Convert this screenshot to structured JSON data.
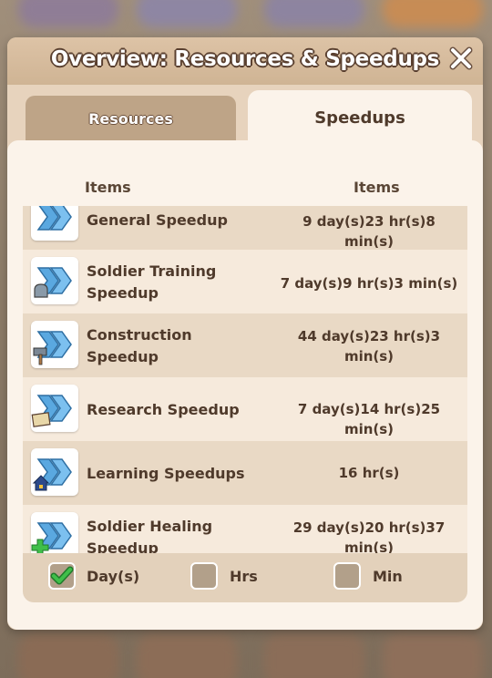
{
  "dialog": {
    "title": "Overview: Resources & Speedups",
    "tabs": [
      {
        "label": "Resources",
        "active": false
      },
      {
        "label": "Speedups",
        "active": true
      }
    ],
    "columns": [
      "Items",
      "Items"
    ]
  },
  "items": [
    {
      "name_line1": "General Speedup",
      "name_line2": "",
      "time_line1": "9 day(s)23 hr(s)8 min(s)",
      "time_line2": "",
      "icon": "general-speedup-icon"
    },
    {
      "name_line1": "Soldier Training",
      "name_line2": "Speedup",
      "time_line1": "7 day(s)9 hr(s)3 min(s)",
      "time_line2": "",
      "icon": "training-speedup-icon"
    },
    {
      "name_line1": "Construction",
      "name_line2": "Speedup",
      "time_line1": "44 day(s)23 hr(s)3",
      "time_line2": "min(s)",
      "icon": "construction-speedup-icon"
    },
    {
      "name_line1": "Research Speedup",
      "name_line2": "",
      "time_line1": "7 day(s)14 hr(s)25 min(s)",
      "time_line2": "",
      "icon": "research-speedup-icon"
    },
    {
      "name_line1": "Learning Speedups",
      "name_line2": "",
      "time_line1": "16 hr(s)",
      "time_line2": "",
      "icon": "learning-speedup-icon"
    },
    {
      "name_line1": "Soldier Healing",
      "name_line2": "Speedup",
      "time_line1": "29 day(s)20 hr(s)37",
      "time_line2": "min(s)",
      "icon": "healing-speedup-icon"
    }
  ],
  "footer": {
    "options": [
      {
        "label": "Day(s)",
        "checked": true
      },
      {
        "label": "Hrs",
        "checked": false
      },
      {
        "label": "Min",
        "checked": false
      }
    ]
  },
  "colors": {
    "check": "#3fbf4a",
    "chevron": "#5aa8e0",
    "panel": "#fbf3ea"
  }
}
